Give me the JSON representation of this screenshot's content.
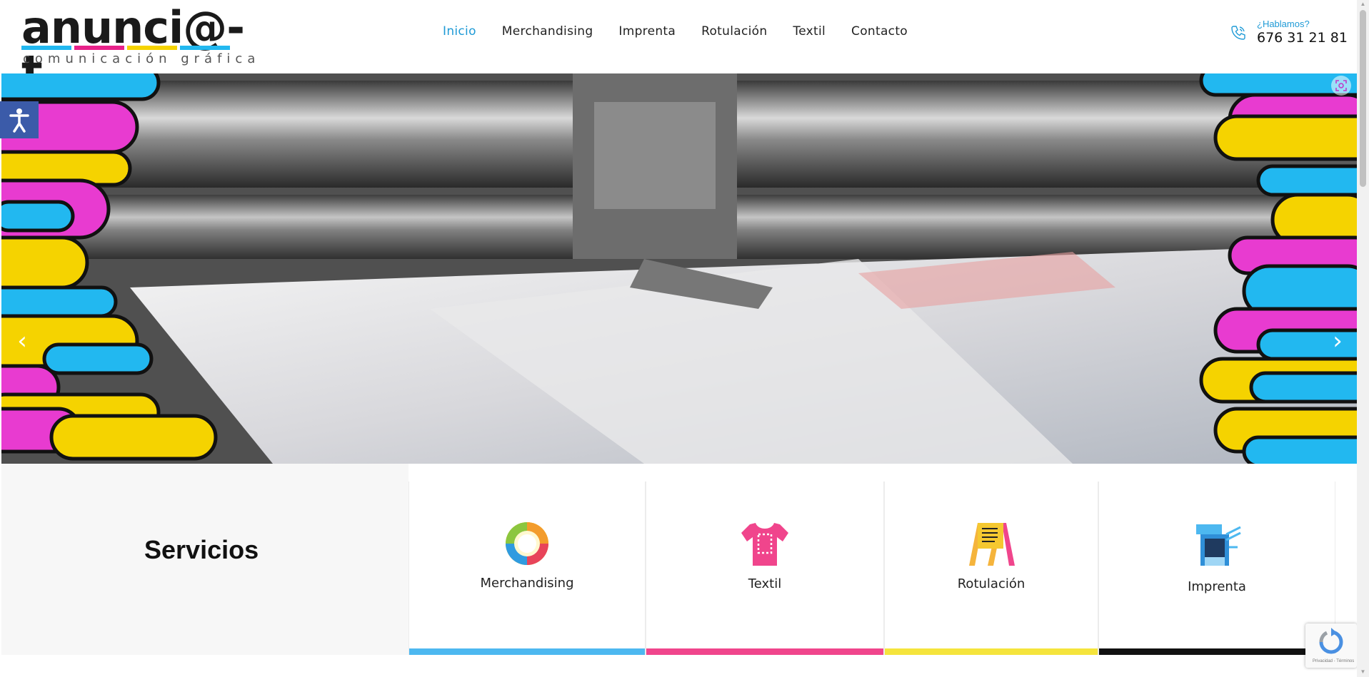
{
  "header": {
    "logo_text": "anunci@-t",
    "logo_subtitle": "comunicación gráfica",
    "nav": [
      {
        "label": "Inicio",
        "active": true
      },
      {
        "label": "Merchandising",
        "active": false
      },
      {
        "label": "Imprenta",
        "active": false
      },
      {
        "label": "Rotulación",
        "active": false
      },
      {
        "label": "Textil",
        "active": false
      },
      {
        "label": "Contacto",
        "active": false
      }
    ],
    "phone": {
      "label": "¿Hablamos?",
      "number": "676 31 21 81",
      "icon": "phone-icon"
    }
  },
  "hero": {
    "prev_arrow": "‹",
    "next_arrow": "›",
    "image_alt": "Imprenta offset"
  },
  "services": {
    "title": "Servicios",
    "items": [
      {
        "label": "Merchandising",
        "icon": "merchandising-icon",
        "color": "#4db8f0"
      },
      {
        "label": "Textil",
        "icon": "tshirt-icon",
        "color": "#f0458c"
      },
      {
        "label": "Rotulación",
        "icon": "sign-board-icon",
        "color": "#f5e43c"
      },
      {
        "label": "Imprenta",
        "icon": "printer-icon",
        "color": "#111111"
      }
    ]
  },
  "recaptcha": {
    "text": "Privacidad - Términos"
  },
  "colors": {
    "accent": "#1e9ad6",
    "cyan": "#22b8f0",
    "magenta": "#e83bd0",
    "yellow": "#f5d300",
    "black": "#111111"
  }
}
